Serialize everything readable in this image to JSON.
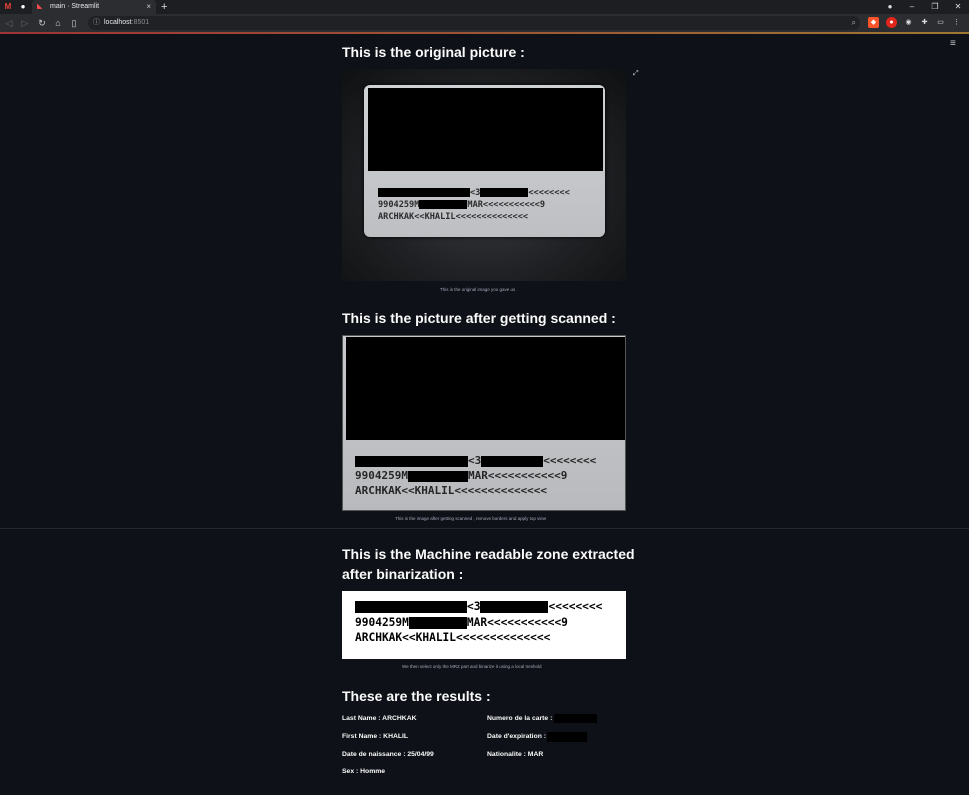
{
  "browser": {
    "tab_title": "main · Streamlit",
    "new_tab": "+",
    "url_host": "localhost",
    "url_port": ":8501",
    "tab_close": "×",
    "window": {
      "minimize": "–",
      "restore": "❐",
      "close": "✕"
    }
  },
  "app": {
    "menu_icon": "≡",
    "sections": {
      "original_title": "This is the original picture :",
      "original_caption": "This is the original image you gave us",
      "scanned_title": "This is the picture after getting scanned :",
      "scanned_caption": "This is the image after getting scanned , remove borders and apply top view",
      "mrz_title_1": "This is the Machine readable zone extracted",
      "mrz_title_2": "after binarization :",
      "mrz_caption": "We then select only the MRZ part and binarize it using a local treshold",
      "results_title": "These are the results :"
    },
    "mrz_lines": {
      "line1_part1": "<3",
      "line1_part2": "<<<<<<<<",
      "line2_part1": "9904259M",
      "line2_part2": "MAR<<<<<<<<<<<9",
      "line3": "ARCHKAK<<KHALIL<<<<<<<<<<<<<<"
    },
    "results": {
      "last_name": "Last Name : ARCHKAK",
      "first_name": "First Name : KHALIL",
      "birth_date": "Date de naissance : 25/04/99",
      "sex": "Sex : Homme",
      "card_number": "Numero de la carte :",
      "expiry_date": "Date d'expiration :",
      "nationality": "Nationalite : MAR"
    }
  }
}
